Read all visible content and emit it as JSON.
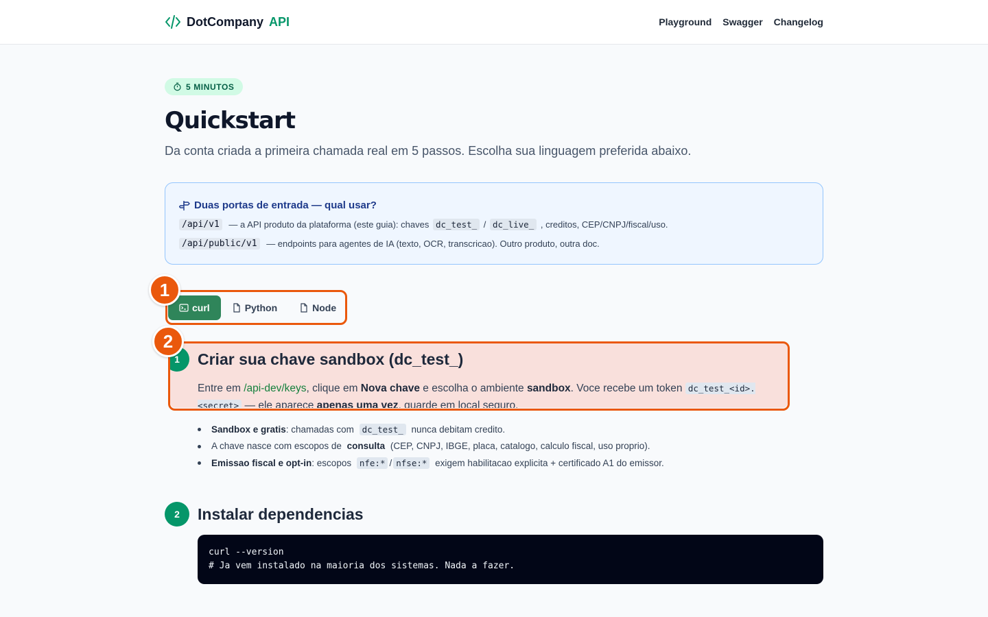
{
  "header": {
    "logo_name": "DotCompany",
    "logo_accent": "API",
    "nav": [
      "Playground",
      "Swagger",
      "Changelog"
    ]
  },
  "badge": {
    "icon": "timer-icon",
    "label": "5 MINUTOS"
  },
  "page": {
    "title": "Quickstart",
    "lead": "Da conta criada a primeira chamada real em 5 passos. Escolha sua linguagem preferida abaixo."
  },
  "callout": {
    "icon": "signpost-icon",
    "title": "Duas portas de entrada — qual usar?",
    "line1": {
      "path": "/api/v1",
      "text_a": " — a API produto da plataforma (este guia): chaves ",
      "key1": "dc_test_",
      "sep": " / ",
      "key2": "dc_live_",
      "text_b": " , creditos, CEP/CNPJ/fiscal/uso."
    },
    "line2": {
      "path": "/api/public/v1",
      "text": " — endpoints para agentes de IA (texto, OCR, transcricao). Outro produto, outra doc."
    }
  },
  "tabs": [
    {
      "label": "curl",
      "icon": "terminal-icon",
      "active": true
    },
    {
      "label": "Python",
      "icon": "file-icon",
      "active": false
    },
    {
      "label": "Node",
      "icon": "file-icon",
      "active": false
    }
  ],
  "annotations": [
    "1",
    "2"
  ],
  "steps": [
    {
      "number": "1",
      "title": "Criar sua chave sandbox (dc_test_)",
      "desc": {
        "t1": "Entre em ",
        "link": "/api-dev/keys",
        "t2": ", clique em ",
        "b1": "Nova chave",
        "t3": " e escolha o ambiente ",
        "b2": "sandbox",
        "t4": ". Voce recebe um token ",
        "code": "dc_test_<id>.<secret>",
        "t5": " — ele aparece ",
        "b3": "apenas uma vez",
        "t6": ", guarde em local seguro."
      },
      "bullets": [
        {
          "bold": "Sandbox e gratis",
          "text": ": chamadas com ",
          "code": "dc_test_",
          "text2": " nunca debitam credito."
        },
        {
          "pre": "A chave nasce com escopos de ",
          "bold": "consulta",
          "text": " (CEP, CNPJ, IBGE, placa, catalogo, calculo fiscal, uso proprio)."
        },
        {
          "bold": "Emissao fiscal e opt-in",
          "text": ": escopos ",
          "code1": "nfe:*",
          "sep": "/",
          "code2": "nfse:*",
          "text2": " exigem habilitacao explicita + certificado A1 do emissor."
        }
      ]
    },
    {
      "number": "2",
      "title": "Instalar dependencias",
      "code_lines": [
        "curl --version",
        "# Ja vem instalado na maioria dos sistemas. Nada a fazer."
      ]
    }
  ],
  "colors": {
    "brand": "#059669",
    "active_tab": "#2f855a",
    "annotation": "#ea580c",
    "callout_border": "#93c5fd",
    "code_bg": "#020617"
  }
}
